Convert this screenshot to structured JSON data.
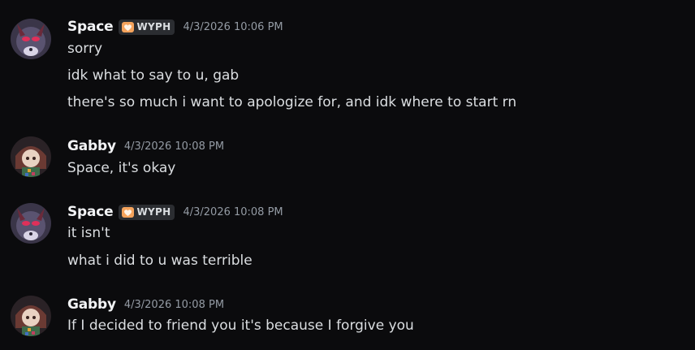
{
  "messages": [
    {
      "author": "Space",
      "tag": "WYPH",
      "timestamp": "4/3/2026 10:06 PM",
      "lines": [
        "sorry",
        "idk what to say to u, gab",
        "there's so much i want to apologize for, and idk where to start rn"
      ]
    },
    {
      "author": "Gabby",
      "timestamp": "4/3/2026 10:08 PM",
      "lines": [
        "Space, it's okay"
      ]
    },
    {
      "author": "Space",
      "tag": "WYPH",
      "timestamp": "4/3/2026 10:08 PM",
      "lines": [
        "it isn't",
        "what i did to u was terrible"
      ]
    },
    {
      "author": "Gabby",
      "timestamp": "4/3/2026 10:08 PM",
      "lines": [
        "If I decided to friend you it's because I forgive you"
      ]
    }
  ],
  "colors": {
    "background": "#0b0b0d",
    "username": "#f2f3f5",
    "message_text": "#dbdee1",
    "timestamp": "#949ba4",
    "tag_background": "#2b2d31",
    "tag_heart": "#f5a35c"
  }
}
